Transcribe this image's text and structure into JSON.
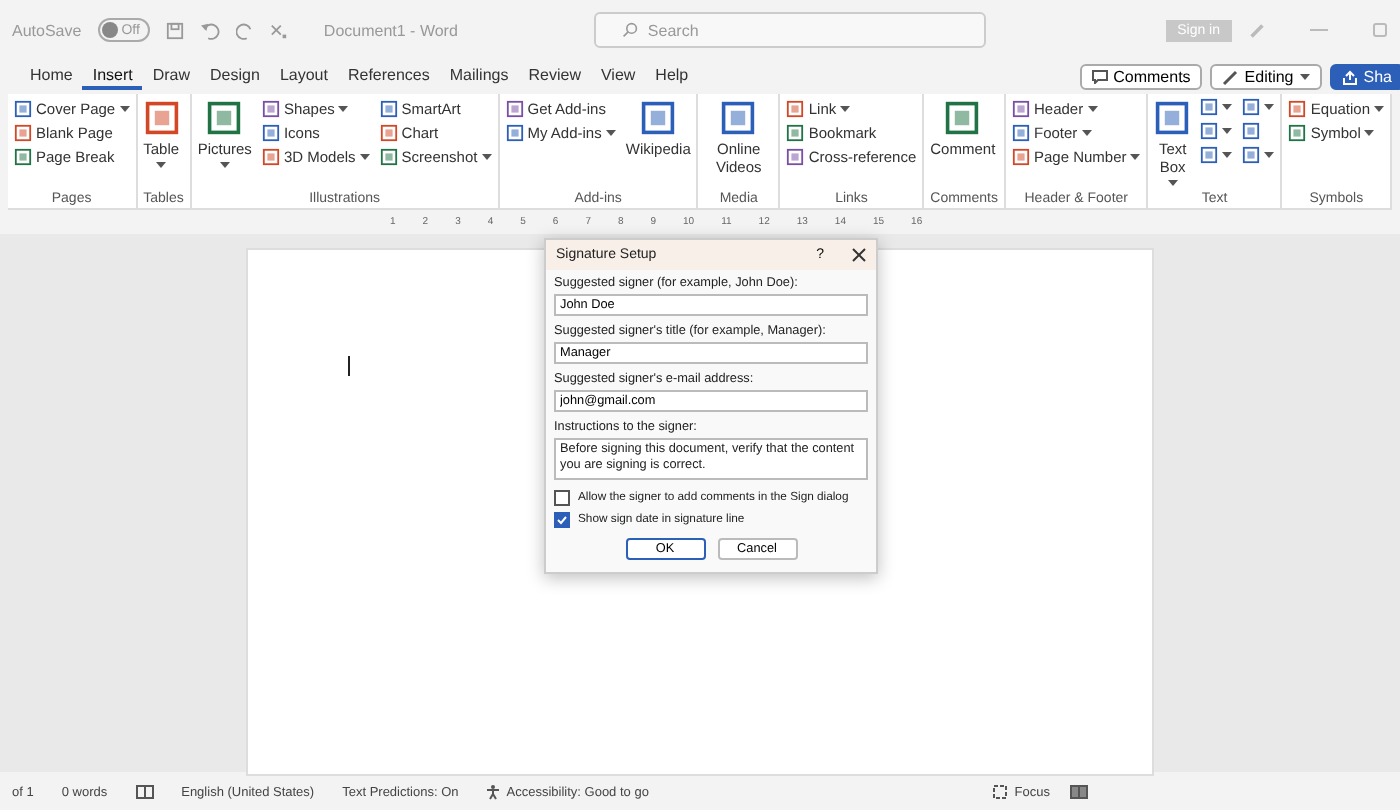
{
  "title_bar": {
    "autosave_label": "AutoSave",
    "autosave": {
      "on": false,
      "label": "Off"
    },
    "document_title": "Document1 - Word",
    "search": {
      "placeholder": "Search"
    },
    "sign_in": "Sign in"
  },
  "tabs": [
    {
      "label": "Home",
      "selected": false
    },
    {
      "label": "Insert",
      "selected": true
    },
    {
      "label": "Draw",
      "selected": false
    },
    {
      "label": "Design",
      "selected": false
    },
    {
      "label": "Layout",
      "selected": false
    },
    {
      "label": "References",
      "selected": false
    },
    {
      "label": "Mailings",
      "selected": false
    },
    {
      "label": "Review",
      "selected": false
    },
    {
      "label": "View",
      "selected": false
    },
    {
      "label": "Help",
      "selected": false
    }
  ],
  "tab_actions": {
    "comments": "Comments",
    "editing": "Editing",
    "share": "Sha"
  },
  "ribbon": [
    {
      "label": "Pages",
      "columns": [
        {
          "kind": "stack",
          "items": [
            {
              "label": "Cover Page",
              "has_menu": true
            },
            {
              "label": "Blank Page",
              "has_menu": false
            },
            {
              "label": "Page Break",
              "has_menu": false
            }
          ]
        }
      ]
    },
    {
      "label": "Tables",
      "columns": [
        {
          "kind": "large",
          "items": [
            {
              "label": "Table",
              "has_menu": true
            }
          ]
        }
      ]
    },
    {
      "label": "Illustrations",
      "columns": [
        {
          "kind": "large",
          "items": [
            {
              "label": "Pictures",
              "has_menu": true
            }
          ]
        },
        {
          "kind": "stack",
          "items": [
            {
              "label": "Shapes",
              "has_menu": true
            },
            {
              "label": "Icons",
              "has_menu": false
            },
            {
              "label": "3D Models",
              "has_menu": true
            }
          ]
        },
        {
          "kind": "stack",
          "items": [
            {
              "label": "SmartArt",
              "has_menu": false
            },
            {
              "label": "Chart",
              "has_menu": false
            },
            {
              "label": "Screenshot",
              "has_menu": true
            }
          ]
        }
      ]
    },
    {
      "label": "Add-ins",
      "columns": [
        {
          "kind": "stack",
          "items": [
            {
              "label": "Get Add-ins",
              "has_menu": false
            },
            {
              "label": "My Add-ins",
              "has_menu": true
            }
          ]
        },
        {
          "kind": "large",
          "items": [
            {
              "label": "Wikipedia",
              "has_menu": false
            }
          ]
        }
      ]
    },
    {
      "label": "Media",
      "columns": [
        {
          "kind": "large",
          "items": [
            {
              "label": "Online Videos",
              "has_menu": false
            }
          ]
        }
      ]
    },
    {
      "label": "Links",
      "columns": [
        {
          "kind": "stack",
          "items": [
            {
              "label": "Link",
              "has_menu": true
            },
            {
              "label": "Bookmark",
              "has_menu": false
            },
            {
              "label": "Cross-reference",
              "has_menu": false
            }
          ]
        }
      ]
    },
    {
      "label": "Comments",
      "columns": [
        {
          "kind": "large",
          "items": [
            {
              "label": "Comment",
              "has_menu": false
            }
          ]
        }
      ]
    },
    {
      "label": "Header & Footer",
      "columns": [
        {
          "kind": "stack",
          "items": [
            {
              "label": "Header",
              "has_menu": true
            },
            {
              "label": "Footer",
              "has_menu": true
            },
            {
              "label": "Page Number",
              "has_menu": true
            }
          ]
        }
      ]
    },
    {
      "label": "Text",
      "columns": [
        {
          "kind": "large",
          "items": [
            {
              "label": "Text Box",
              "has_menu": true
            }
          ]
        },
        {
          "kind": "icons",
          "items": [
            {
              "has_menu": true
            },
            {
              "has_menu": true
            },
            {
              "has_menu": true
            }
          ]
        },
        {
          "kind": "icons",
          "items": [
            {
              "has_menu": true
            },
            {
              "has_menu": false
            },
            {
              "has_menu": true
            }
          ]
        }
      ]
    },
    {
      "label": "Symbols",
      "columns": [
        {
          "kind": "stack",
          "items": [
            {
              "label": "Equation",
              "has_menu": true
            },
            {
              "label": "Symbol",
              "has_menu": true
            }
          ]
        }
      ]
    }
  ],
  "ruler": {
    "labels": [
      "1",
      "2",
      "3",
      "4",
      "5",
      "6",
      "7",
      "8",
      "9",
      "10",
      "11",
      "12",
      "13",
      "14",
      "15",
      "16"
    ]
  },
  "dialog": {
    "title": "Signature Setup",
    "help": "?",
    "fields": [
      {
        "label": "Suggested signer (for example, John Doe):",
        "value": "John Doe"
      },
      {
        "label": "Suggested signer's title (for example, Manager):",
        "value": "Manager"
      },
      {
        "label": "Suggested signer's e-mail address:",
        "value": "john@gmail.com"
      }
    ],
    "instructions": {
      "label": "Instructions to the signer:",
      "value": "Before signing this document, verify that the content you are signing is correct."
    },
    "checkboxes": [
      {
        "label": "Allow the signer to add comments in the Sign dialog",
        "checked": false
      },
      {
        "label": "Show sign date in signature line",
        "checked": true
      }
    ],
    "buttons": [
      {
        "label": "OK",
        "default": true
      },
      {
        "label": "Cancel",
        "default": false
      }
    ]
  },
  "status_bar": {
    "page": "of 1",
    "words": "0 words",
    "language": "English (United States)",
    "predictions": "Text Predictions: On",
    "accessibility": "Accessibility: Good to go",
    "focus": "Focus"
  }
}
